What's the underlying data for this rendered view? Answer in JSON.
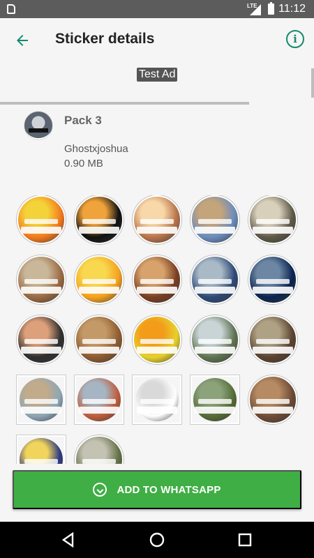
{
  "status_bar": {
    "network": "LTE",
    "time": "11:12"
  },
  "toolbar": {
    "title": "Sticker details",
    "back_icon": "arrow-left-icon",
    "info_icon": "info-icon",
    "accent_color": "#148a6d"
  },
  "ad": {
    "label": "Test Ad"
  },
  "pack": {
    "name": "Pack 3",
    "publisher": "Ghostxjoshua",
    "size": "0.90 MB"
  },
  "stickers": [
    {
      "colors": [
        "#f37a1d",
        "#f4d23a"
      ],
      "frame": "circle"
    },
    {
      "colors": [
        "#111111",
        "#f0a33a"
      ],
      "frame": "circle"
    },
    {
      "colors": [
        "#b8744a",
        "#f8d7a8"
      ],
      "frame": "circle"
    },
    {
      "colors": [
        "#6b8cbc",
        "#c3a47b"
      ],
      "frame": "circle"
    },
    {
      "colors": [
        "#5e5848",
        "#d8d0bb"
      ],
      "frame": "circle"
    },
    {
      "colors": [
        "#9a6a42",
        "#c9b79a"
      ],
      "frame": "circle"
    },
    {
      "colors": [
        "#f5a11f",
        "#f8d84e"
      ],
      "frame": "circle"
    },
    {
      "colors": [
        "#7a3f23",
        "#d7a26b"
      ],
      "frame": "circle"
    },
    {
      "colors": [
        "#2d4977",
        "#a9b9c6"
      ],
      "frame": "circle"
    },
    {
      "colors": [
        "#0a2450",
        "#6c86a4"
      ],
      "frame": "circle"
    },
    {
      "colors": [
        "#2f2f2f",
        "#dca07a"
      ],
      "frame": "circle"
    },
    {
      "colors": [
        "#8e5c30",
        "#c39a67"
      ],
      "frame": "circle"
    },
    {
      "colors": [
        "#e7d12c",
        "#f39c1a"
      ],
      "frame": "circle"
    },
    {
      "colors": [
        "#5f7352",
        "#c9d4d6"
      ],
      "frame": "circle"
    },
    {
      "colors": [
        "#5a4330",
        "#afa184"
      ],
      "frame": "circle"
    },
    {
      "colors": [
        "#8ea7b6",
        "#c1ab8b"
      ],
      "frame": "square"
    },
    {
      "colors": [
        "#bf5d3c",
        "#a6b5c3"
      ],
      "frame": "square"
    },
    {
      "colors": [
        "#ffffff",
        "#d9d9d9"
      ],
      "frame": "square"
    },
    {
      "colors": [
        "#556d38",
        "#8ca27b"
      ],
      "frame": "square"
    },
    {
      "colors": [
        "#6b4a35",
        "#b68a62"
      ],
      "frame": "circle"
    },
    {
      "colors": [
        "#2d3b82",
        "#f1d45b"
      ],
      "frame": "square"
    },
    {
      "colors": [
        "#637147",
        "#c4c2b2"
      ],
      "frame": "circle"
    }
  ],
  "action": {
    "label": "ADD TO WHATSAPP",
    "icon": "whatsapp-icon",
    "color": "#3fae45"
  },
  "navigation": {
    "back_icon": "nav-back-icon",
    "home_icon": "nav-home-icon",
    "recents_icon": "nav-recents-icon"
  }
}
